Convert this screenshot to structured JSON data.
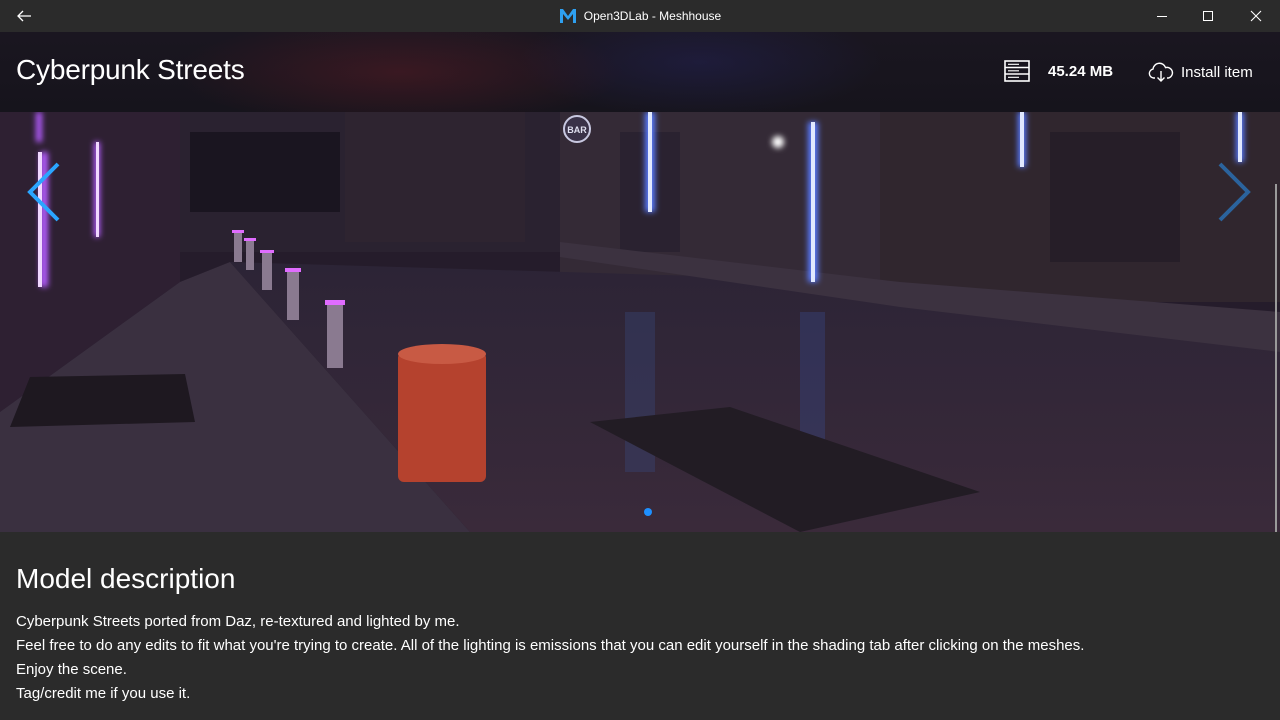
{
  "window": {
    "title": "Open3DLab - Meshhouse",
    "back_icon": "back-arrow-icon",
    "app_icon": "meshhouse-logo-icon",
    "controls": [
      "minimize-icon",
      "maximize-icon",
      "close-icon"
    ]
  },
  "header": {
    "item_title": "Cyberpunk Streets",
    "size": "45.24 MB",
    "size_icon": "storage-icon",
    "install_label": "Install item",
    "install_icon": "cloud-download-icon"
  },
  "gallery": {
    "prev_icon": "chevron-left-icon",
    "next_icon": "chevron-right-icon",
    "accent": "#1e90ff",
    "image_description": "Cyberpunk street scene render",
    "sign_text": "BAR"
  },
  "description": {
    "title": "Model description",
    "lines": [
      "Cyberpunk Streets ported from Daz, re-textured and lighted by me.",
      "Feel free to do any edits to fit what you're trying to create. All of the lighting is emissions that you can edit yourself in the shading tab after clicking on the meshes.",
      "Enjoy the scene.",
      "Tag/credit me if you use it."
    ]
  }
}
